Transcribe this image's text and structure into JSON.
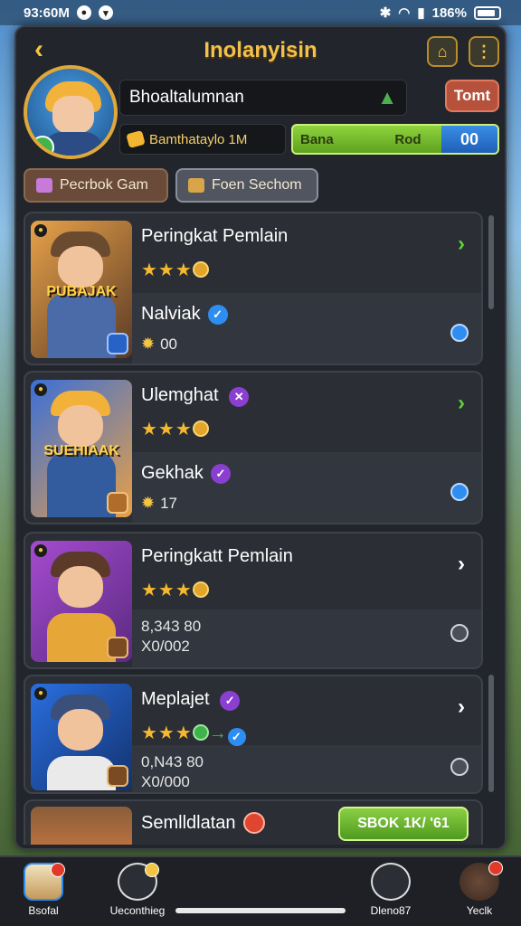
{
  "status": {
    "time": "93:60M",
    "battery": "186%"
  },
  "header": {
    "title": "Inolanyisin",
    "back_icon": "chevron-left-icon",
    "home_icon": "home-icon",
    "menu_icon": "more-vertical-icon"
  },
  "profile": {
    "name": "Bhoaltalumnan",
    "action_button": "Tomt",
    "coins": "Bamthataylo 1M",
    "green_left": "Bana",
    "green_mid": "Rod",
    "green_right": "00"
  },
  "tabs": [
    {
      "label": "Pecrbok Gam"
    },
    {
      "label": "Foen Sechom"
    }
  ],
  "cards": [
    {
      "title": "Peringkat Pemlain",
      "thumb_text": "PUBAJAK",
      "sub": "Nalviak",
      "count": "00",
      "thumb_colors": [
        "#e8a24a",
        "#5a3a25"
      ],
      "hat": "#6b4b30",
      "body": "#4a6aa8"
    },
    {
      "title": "Ulemghat",
      "thumb_text": "SUEHIAAK",
      "sub": "Gekhak",
      "count": "17",
      "thumb_colors": [
        "#3a6fd8",
        "#e8a046"
      ],
      "hat": "#f2b23a",
      "body": "#335c9e"
    },
    {
      "title": "Peringkatt Pemlain",
      "thumb_text": "",
      "stat1": "8,343 80",
      "stat2": "X0/002",
      "thumb_colors": [
        "#a54bd0",
        "#5b2a80"
      ],
      "hat": "#5b3a2a",
      "body": "#e6a638"
    },
    {
      "title": "Meplajet",
      "thumb_text": "",
      "stat1": "0,N43 80",
      "stat2": "X0/000",
      "thumb_colors": [
        "#2a6fe0",
        "#12326e"
      ],
      "hat": "#3a4f7a",
      "body": "#eaeaea"
    }
  ],
  "last": {
    "title": "Semlldlatan",
    "button": "SBOK 1K/ '61"
  },
  "nav": [
    {
      "label": "Bsofal"
    },
    {
      "label": "Ueconthieg"
    },
    {
      "label": "Dleno87"
    },
    {
      "label": "Yeclk"
    }
  ]
}
